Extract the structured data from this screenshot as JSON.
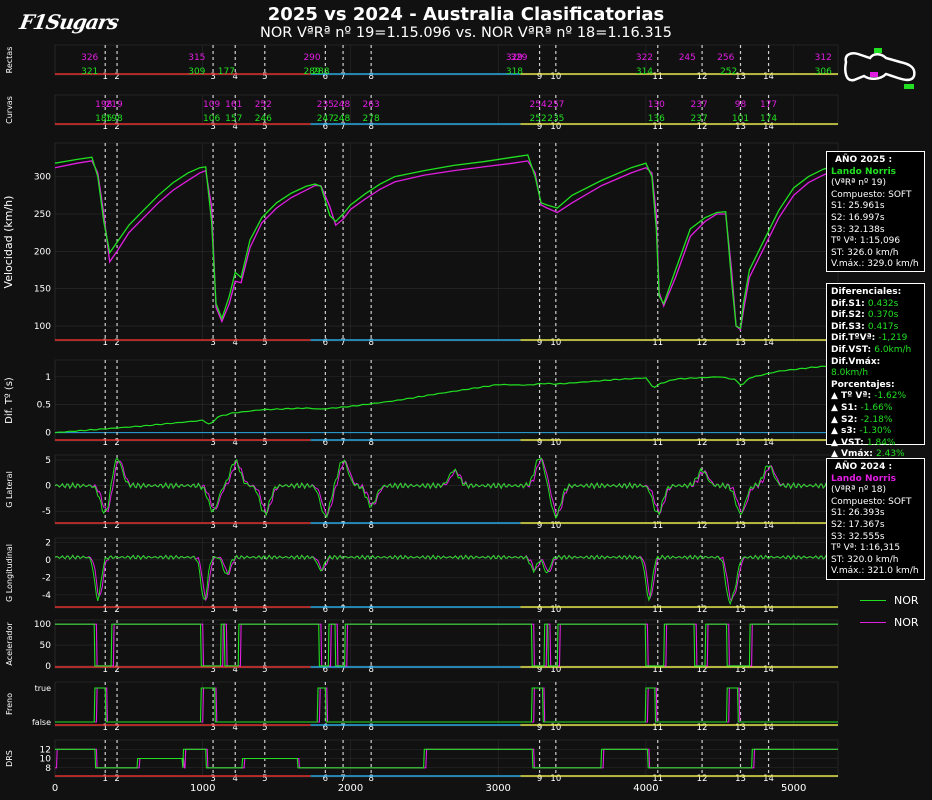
{
  "logo": "F1Sugars",
  "title": "2025 vs 2024 - Australia Clasificatorias",
  "subtitle": "NOR VªRª nº  19=1.15.096 vs. NOR VªRª nº  18=1.16.315",
  "colors": {
    "y2025": "#21e021",
    "y2024": "#e11ee1",
    "s1": "#e0302e",
    "s2": "#29a6e0",
    "s3": "#e6e64a"
  },
  "info_2025": {
    "header": "AÑO 2025 :",
    "driver": "Lando Norris",
    "lap": "(VªRª nº 19)",
    "compound": "Compuesto: SOFT",
    "s1": "S1: 25.961s",
    "s2": "S2: 16.997s",
    "s3": "S3: 32.138s",
    "lap_time": "Tº Vª: 1:15,096",
    "st": "ST: 326.0 km/h",
    "vmax": "V.máx.: 329.0 km/h"
  },
  "info_2024": {
    "header": "AÑO 2024 :",
    "driver": "Lando Norris",
    "lap": "(VªRª nº 18)",
    "compound": "Compuesto: SOFT",
    "s1": "S1: 26.393s",
    "s2": "S2: 17.367s",
    "s3": "S3: 32.555s",
    "lap_time": "Tº Vª: 1:16,315",
    "st": "ST: 320.0 km/h",
    "vmax": "V.máx.: 321.0 km/h"
  },
  "diffs": {
    "header": "Diferenciales:",
    "rows": [
      {
        "label": "Dif.S1:",
        "value": "0.432s"
      },
      {
        "label": "Dif.S2:",
        "value": "0.370s"
      },
      {
        "label": "Dif.S3:",
        "value": "0.417s"
      },
      {
        "label": "Dif.TºVª:",
        "value": "-1,219"
      },
      {
        "label": "Dif.VST:",
        "value": "6.0km/h"
      },
      {
        "label": "Dif.Vmáx:",
        "value": "8.0km/h"
      }
    ],
    "pct_header": "Porcentajes:",
    "pct_rows": [
      {
        "label": "▲ Tº Vª:",
        "value": "-1.62%"
      },
      {
        "label": "▲ S1:",
        "value": "-1.66%"
      },
      {
        "label": "▲ S2:",
        "value": "-2.18%"
      },
      {
        "label": "▲ s3:",
        "value": "-1.30%"
      },
      {
        "label": "▲ VST:",
        "value": "1.84%"
      },
      {
        "label": "▲ Vmáx:",
        "value": "2.43%"
      }
    ]
  },
  "legend": [
    {
      "name": "NOR",
      "color": "#21e021"
    },
    {
      "name": "NOR",
      "color": "#e11ee1"
    }
  ],
  "chart_data": {
    "type": "line",
    "x_range": [
      0,
      5300
    ],
    "x_ticks": [
      0,
      1000,
      2000,
      3000,
      4000,
      5000
    ],
    "corners": [
      {
        "n": "1",
        "x": 340
      },
      {
        "n": "2",
        "x": 420
      },
      {
        "n": "3",
        "x": 1070
      },
      {
        "n": "4",
        "x": 1220
      },
      {
        "n": "5",
        "x": 1420
      },
      {
        "n": "6",
        "x": 1830
      },
      {
        "n": "7",
        "x": 1950
      },
      {
        "n": "8",
        "x": 2140
      },
      {
        "n": "9",
        "x": 3280
      },
      {
        "n": "10",
        "x": 3390
      },
      {
        "n": "11",
        "x": 4080
      },
      {
        "n": "12",
        "x": 4380
      },
      {
        "n": "13",
        "x": 4640
      },
      {
        "n": "14",
        "x": 4830
      }
    ],
    "sectors": [
      {
        "from": 0,
        "to": 1730,
        "color": "s1"
      },
      {
        "from": 1730,
        "to": 3150,
        "color": "s2"
      },
      {
        "from": 3150,
        "to": 5300,
        "color": "s3"
      }
    ],
    "rectas": {
      "ylabel": "Rectas",
      "labels_2025": [
        {
          "x": 235,
          "v": "326"
        },
        {
          "x": 960,
          "v": "315"
        },
        {
          "x": 1740,
          "v": "290"
        },
        {
          "x": 3110,
          "v": "329"
        },
        {
          "x": 3140,
          "v": "329"
        },
        {
          "x": 3990,
          "v": "322"
        },
        {
          "x": 4280,
          "v": "245"
        },
        {
          "x": 4540,
          "v": "256"
        },
        {
          "x": 5200,
          "v": "312"
        }
      ],
      "labels_2024": [
        {
          "x": 235,
          "v": "321"
        },
        {
          "x": 960,
          "v": "309"
        },
        {
          "x": 1160,
          "v": "177"
        },
        {
          "x": 1740,
          "v": "289"
        },
        {
          "x": 1800,
          "v": "288"
        },
        {
          "x": 3110,
          "v": "318"
        },
        {
          "x": 3990,
          "v": "314"
        },
        {
          "x": 4560,
          "v": "252"
        },
        {
          "x": 5200,
          "v": "306"
        }
      ]
    },
    "curvas": {
      "ylabel": "Curvas",
      "labels_2025": [
        {
          "x": 330,
          "v": "198"
        },
        {
          "x": 400,
          "v": "219"
        },
        {
          "x": 1060,
          "v": "109"
        },
        {
          "x": 1210,
          "v": "161"
        },
        {
          "x": 1410,
          "v": "252"
        },
        {
          "x": 1830,
          "v": "235"
        },
        {
          "x": 1940,
          "v": "248"
        },
        {
          "x": 2140,
          "v": "263"
        },
        {
          "x": 3270,
          "v": "254"
        },
        {
          "x": 3390,
          "v": "257"
        },
        {
          "x": 4070,
          "v": "130"
        },
        {
          "x": 4360,
          "v": "237"
        },
        {
          "x": 4640,
          "v": "98"
        },
        {
          "x": 4830,
          "v": "177"
        }
      ],
      "labels_2024": [
        {
          "x": 330,
          "v": "185"
        },
        {
          "x": 400,
          "v": "198"
        },
        {
          "x": 1060,
          "v": "106"
        },
        {
          "x": 1210,
          "v": "157"
        },
        {
          "x": 1410,
          "v": "246"
        },
        {
          "x": 1830,
          "v": "247"
        },
        {
          "x": 1940,
          "v": "248"
        },
        {
          "x": 2140,
          "v": "278"
        },
        {
          "x": 3270,
          "v": "252"
        },
        {
          "x": 3390,
          "v": "235"
        },
        {
          "x": 4070,
          "v": "136"
        },
        {
          "x": 4360,
          "v": "237"
        },
        {
          "x": 4640,
          "v": "101"
        },
        {
          "x": 4830,
          "v": "174"
        }
      ]
    },
    "speed": {
      "ylabel": "Velocidad (km/h)",
      "ylim": [
        80,
        345
      ],
      "yticks": [
        100,
        150,
        200,
        250,
        300
      ],
      "series": [
        {
          "year": "2025",
          "color": "y2025",
          "x": [
            0,
            150,
            250,
            290,
            330,
            370,
            420,
            500,
            600,
            700,
            800,
            900,
            980,
            1020,
            1060,
            1090,
            1130,
            1180,
            1220,
            1260,
            1320,
            1400,
            1500,
            1600,
            1700,
            1760,
            1800,
            1860,
            1900,
            1950,
            2000,
            2100,
            2200,
            2300,
            2500,
            2700,
            2900,
            3100,
            3200,
            3250,
            3290,
            3330,
            3400,
            3500,
            3700,
            3900,
            4000,
            4040,
            4070,
            4090,
            4120,
            4200,
            4300,
            4400,
            4480,
            4540,
            4580,
            4610,
            4640,
            4660,
            4700,
            4800,
            4900,
            5000,
            5100,
            5200,
            5300
          ],
          "y": [
            318,
            323,
            326,
            300,
            240,
            198,
            212,
            235,
            255,
            275,
            292,
            305,
            312,
            313,
            240,
            130,
            110,
            140,
            172,
            165,
            215,
            245,
            265,
            278,
            287,
            290,
            287,
            248,
            240,
            250,
            262,
            277,
            290,
            300,
            308,
            315,
            320,
            326,
            329,
            300,
            265,
            262,
            258,
            275,
            295,
            312,
            318,
            300,
            230,
            140,
            130,
            175,
            230,
            245,
            252,
            253,
            160,
            100,
            97,
            130,
            175,
            215,
            255,
            285,
            300,
            310,
            316
          ]
        },
        {
          "year": "2024",
          "color": "y2024",
          "x": [
            0,
            150,
            250,
            290,
            330,
            370,
            420,
            500,
            600,
            700,
            800,
            900,
            980,
            1020,
            1060,
            1090,
            1130,
            1180,
            1220,
            1260,
            1320,
            1400,
            1500,
            1600,
            1700,
            1760,
            1800,
            1860,
            1900,
            1950,
            2000,
            2100,
            2200,
            2300,
            2500,
            2700,
            2900,
            3100,
            3200,
            3250,
            3290,
            3330,
            3400,
            3500,
            3700,
            3900,
            4000,
            4040,
            4070,
            4090,
            4120,
            4200,
            4300,
            4400,
            4480,
            4540,
            4580,
            4610,
            4640,
            4660,
            4700,
            4800,
            4900,
            5000,
            5100,
            5200,
            5300
          ],
          "y": [
            312,
            318,
            321,
            305,
            250,
            186,
            200,
            225,
            245,
            265,
            282,
            295,
            305,
            308,
            260,
            125,
            106,
            130,
            160,
            158,
            205,
            238,
            258,
            272,
            282,
            288,
            288,
            260,
            235,
            243,
            256,
            270,
            283,
            293,
            302,
            308,
            313,
            318,
            321,
            305,
            262,
            258,
            252,
            265,
            288,
            305,
            312,
            305,
            250,
            145,
            127,
            165,
            220,
            240,
            250,
            250,
            175,
            100,
            95,
            120,
            165,
            205,
            245,
            275,
            292,
            302,
            310
          ]
        }
      ]
    },
    "delta": {
      "ylabel": "Dif. Tº (s)",
      "ylim": [
        -0.15,
        1.3
      ],
      "yticks": [
        0,
        0.5,
        1
      ],
      "x": [
        0,
        300,
        400,
        600,
        800,
        1000,
        1050,
        1100,
        1200,
        1400,
        1700,
        1800,
        2000,
        2300,
        2600,
        3000,
        3200,
        3300,
        3400,
        3800,
        4000,
        4050,
        4100,
        4200,
        4500,
        4600,
        4650,
        4700,
        4900,
        5100,
        5300
      ],
      "y": [
        0,
        0.06,
        0.08,
        0.12,
        0.17,
        0.22,
        0.14,
        0.28,
        0.35,
        0.41,
        0.44,
        0.42,
        0.47,
        0.57,
        0.7,
        0.86,
        0.85,
        0.88,
        0.87,
        0.95,
        0.98,
        0.8,
        0.88,
        0.96,
        1.0,
        0.95,
        0.84,
        0.98,
        1.1,
        1.16,
        1.21
      ]
    },
    "g_lateral": {
      "ylabel": "G Lateral",
      "ylim": [
        -7.5,
        6
      ],
      "yticks": [
        -5,
        0,
        5
      ]
    },
    "g_longitudinal": {
      "ylabel": "G Longitudinal",
      "ylim": [
        -5.5,
        2.5
      ],
      "yticks": [
        -4,
        -2,
        0,
        2
      ]
    },
    "throttle": {
      "ylabel": "Acelerador",
      "ylim": [
        -5,
        110
      ],
      "yticks": [
        0,
        50,
        100
      ]
    },
    "brake": {
      "ylabel": "Freno",
      "yticks": [
        "false",
        "true"
      ]
    },
    "drs": {
      "ylabel": "DRS",
      "ylim": [
        6,
        14
      ],
      "yticks": [
        8,
        10,
        12
      ]
    }
  }
}
